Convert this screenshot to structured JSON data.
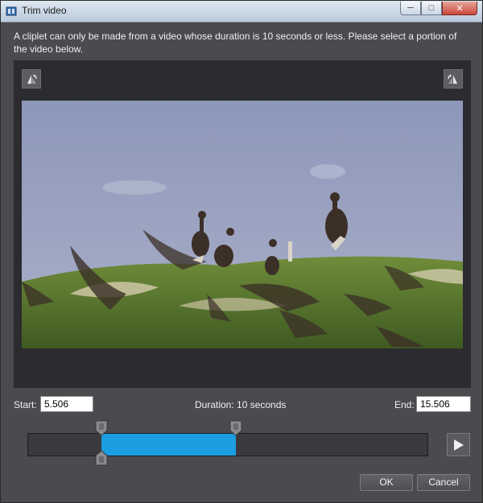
{
  "window": {
    "title": "Trim video",
    "minimize_glyph": "─",
    "maximize_glyph": "□",
    "close_glyph": "✕"
  },
  "instructions": "A cliplet can only be made from a video whose duration is 10 seconds or less. Please select a portion of the video below.",
  "video": {
    "rotate_left_icon": "rotate-left-icon",
    "rotate_right_icon": "rotate-right-icon",
    "content": "birds-on-grass-frame"
  },
  "trim": {
    "start_label": "Start:",
    "start_value": "5.506",
    "duration_label": "Duration: 10 seconds",
    "end_label": "End:",
    "end_value": "15.506",
    "selection_start_fraction": 0.183,
    "selection_end_fraction": 0.52,
    "playhead_fraction": 0.183,
    "selection_color": "#1b9ee2"
  },
  "buttons": {
    "ok": "OK",
    "cancel": "Cancel",
    "play_icon": "play-icon"
  }
}
